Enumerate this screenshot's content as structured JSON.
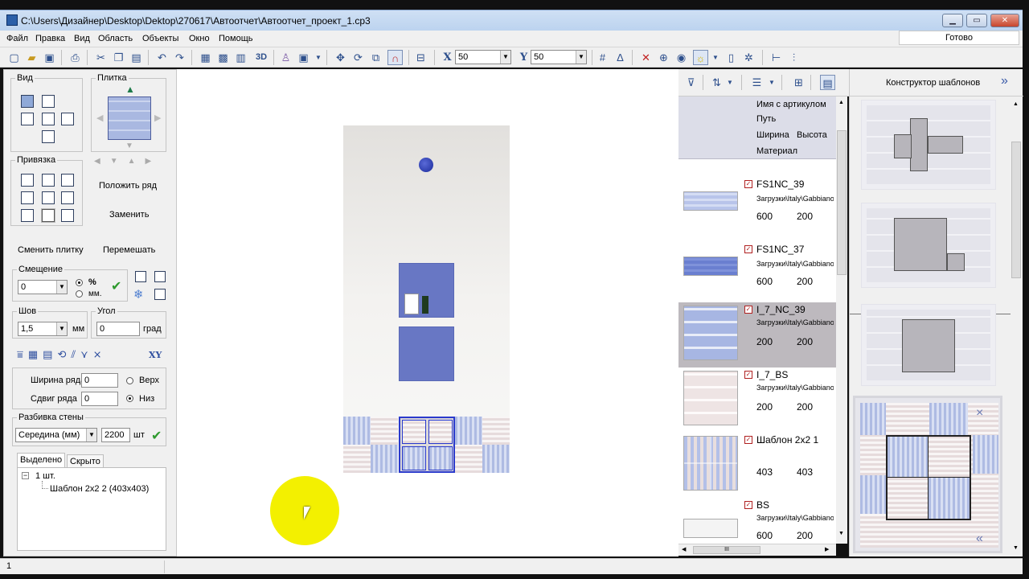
{
  "window": {
    "title": "C:\\Users\\Дизайнер\\Desktop\\Dektop\\270617\\Автоотчет\\Автоотчет_проект_1.cp3",
    "status_ready": "Готово"
  },
  "menu": [
    "Файл",
    "Правка",
    "Вид",
    "Область",
    "Объекты",
    "Окно",
    "Помощь"
  ],
  "toolbar": {
    "x_label": "X",
    "x_value": "50",
    "y_label": "Y",
    "y_value": "50",
    "view3d": "3D"
  },
  "left": {
    "view_label": "Вид",
    "tile_label": "Плитка",
    "snap_label": "Привязка",
    "place_row": "Положить ряд",
    "replace": "Заменить",
    "change_tile": "Сменить плитку",
    "shuffle": "Перемешать",
    "offset_label": "Смещение",
    "offset_value": "0",
    "unit_percent": "%",
    "unit_mm": "мм.",
    "seam_label": "Шов",
    "seam_value": "1,5",
    "seam_unit": "мм",
    "angle_label": "Угол",
    "angle_value": "0",
    "angle_unit": "град",
    "xy": "XY",
    "row_width_label": "Ширина ряда",
    "row_width_value": "0",
    "row_shift_label": "Сдвиг ряда",
    "row_shift_value": "0",
    "top_label": "Верх",
    "bottom_label": "Низ",
    "wall_split_label": "Разбивка стены",
    "wall_split_mode": "Середина (мм)",
    "wall_split_value": "2200",
    "wall_split_unit": "шт",
    "tab_selected": "Выделено",
    "tab_hidden": "Скрыто",
    "tree_root": "1 шт.",
    "tree_child": "Шаблон 2х2 2 (403х403)"
  },
  "list": {
    "header": {
      "name": "Имя с артикулом",
      "path": "Путь",
      "width": "Ширина",
      "height": "Высота",
      "material": "Материал"
    },
    "items": [
      {
        "name": "FS1NC_39",
        "path": "Загрузки\\Italy\\Gabbiano",
        "width": "600",
        "height": "200"
      },
      {
        "name": "FS1NC_37",
        "path": "Загрузки\\Italy\\Gabbiano",
        "width": "600",
        "height": "200"
      },
      {
        "name": "I_7_NC_39",
        "path": "Загрузки\\Italy\\Gabbiano",
        "width": "200",
        "height": "200"
      },
      {
        "name": "I_7_BS",
        "path": "Загрузки\\Italy\\Gabbiano",
        "width": "200",
        "height": "200"
      },
      {
        "name": "Шаблон 2х2 1",
        "path": "",
        "width": "403",
        "height": "403"
      },
      {
        "name": "BS",
        "path": "Загрузки\\Italy\\Gabbiano",
        "width": "600",
        "height": "200"
      }
    ],
    "hscroll_grip": "III"
  },
  "templates": {
    "title": "Конструктор шаблонов",
    "expand": "»",
    "collapse": "«",
    "close": "×"
  },
  "statusbar": {
    "text": "1"
  },
  "colors": {
    "accent": "#2f3f8f",
    "tile_blue": "#6877c4",
    "highlight": "#f3f000",
    "check": "#2e9a2e"
  }
}
